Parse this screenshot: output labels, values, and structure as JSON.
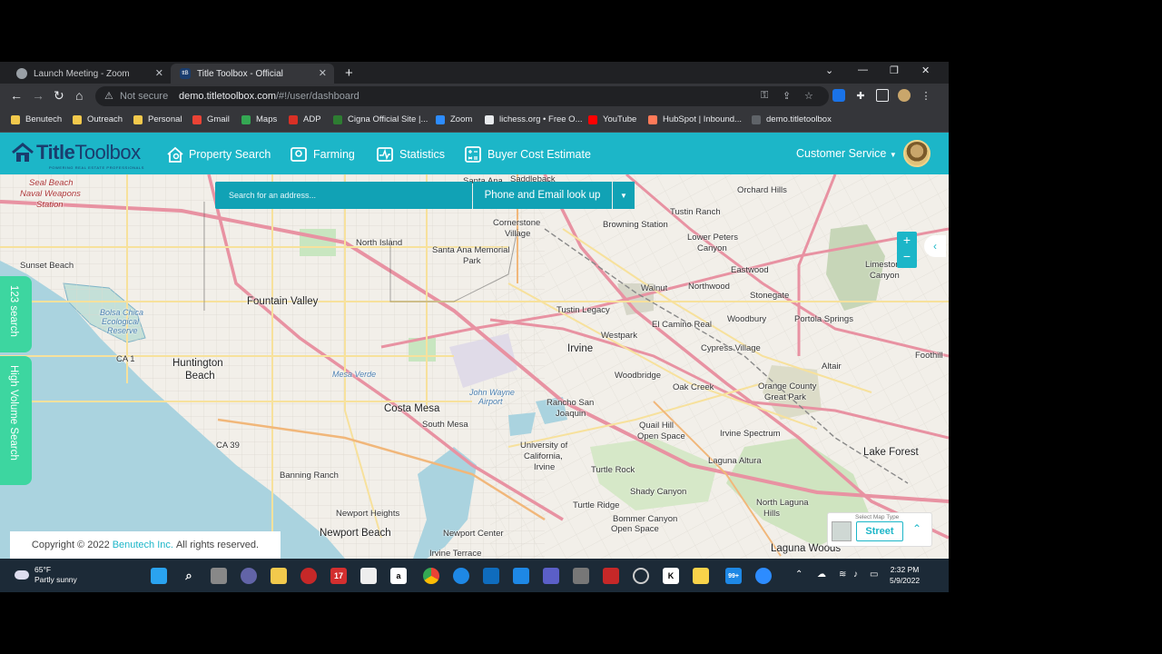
{
  "browser": {
    "tabs": [
      {
        "title": "Launch Meeting - Zoom",
        "active": false
      },
      {
        "title": "Title Toolbox - Official",
        "active": true
      }
    ],
    "security_label": "Not secure",
    "url_host": "demo.titletoolbox.com",
    "url_path": "/#!/user/dashboard",
    "bookmarks": [
      "Benutech",
      "Outreach",
      "Personal",
      "Gmail",
      "Maps",
      "ADP",
      "Cigna Official Site |...",
      "Zoom",
      "lichess.org • Free O...",
      "YouTube",
      "HubSpot | Inbound...",
      "demo.titletoolbox"
    ],
    "bookmark_colors": [
      "#f2c94c",
      "#f2c94c",
      "#f2c94c",
      "#ea4335",
      "#34a853",
      "#d93025",
      "#2e7d32",
      "#2d8cff",
      "#e8eaed",
      "#ff0000",
      "#ff7a59",
      "#5f6368"
    ]
  },
  "app": {
    "logo_bold": "Title",
    "logo_light": "Toolbox",
    "logo_tagline": "POWERING REAL ESTATE PROFESSIONALS",
    "nav": [
      "Property Search",
      "Farming",
      "Statistics",
      "Buyer Cost Estimate"
    ],
    "customer_service": "Customer Service",
    "accent_color": "#1cb6c8",
    "side_tab_color": "#3dd6a0"
  },
  "search": {
    "placeholder": "Search for an address...",
    "phone_button": "Phone and Email look up"
  },
  "side_tabs": [
    "123 search",
    "High Volume Search"
  ],
  "zoom": {
    "plus": "+",
    "minus": "−"
  },
  "map_type": {
    "label": "Select Map Type",
    "current": "Street"
  },
  "footer": {
    "prefix": "Copyright © 2022",
    "company": "Benutech Inc.",
    "suffix": "All rights reserved."
  },
  "map_labels": [
    {
      "text": "Seal Beach",
      "cls": "red"
    },
    {
      "text": "Naval Weapons",
      "cls": "red"
    },
    {
      "text": "Station",
      "cls": "red"
    },
    {
      "text": "Sunset Beach",
      "cls": ""
    },
    {
      "text": "Fountain Valley",
      "cls": "big"
    },
    {
      "text": "Huntington",
      "cls": "big"
    },
    {
      "text": "Beach",
      "cls": "big"
    },
    {
      "text": "Bolsa Chica",
      "cls": "water"
    },
    {
      "text": "Ecological",
      "cls": "water"
    },
    {
      "text": "Reserve",
      "cls": "water"
    },
    {
      "text": "North Island",
      "cls": ""
    },
    {
      "text": "Santa Ana Memorial",
      "cls": ""
    },
    {
      "text": "Park",
      "cls": ""
    },
    {
      "text": "Cornerstone",
      "cls": ""
    },
    {
      "text": "Village",
      "cls": ""
    },
    {
      "text": "Santa Ana",
      "cls": ""
    },
    {
      "text": "Saddleback",
      "cls": ""
    },
    {
      "text": "Browning Station",
      "cls": ""
    },
    {
      "text": "Tustin Ranch",
      "cls": ""
    },
    {
      "text": "Orchard Hills",
      "cls": ""
    },
    {
      "text": "Lower Peters",
      "cls": ""
    },
    {
      "text": "Canyon",
      "cls": ""
    },
    {
      "text": "Eastwood",
      "cls": ""
    },
    {
      "text": "Limestone",
      "cls": ""
    },
    {
      "text": "Canyon",
      "cls": ""
    },
    {
      "text": "Walnut",
      "cls": ""
    },
    {
      "text": "Northwood",
      "cls": ""
    },
    {
      "text": "Stonegate",
      "cls": ""
    },
    {
      "text": "Tustin Legacy",
      "cls": ""
    },
    {
      "text": "El Camino Real",
      "cls": ""
    },
    {
      "text": "Woodbury",
      "cls": ""
    },
    {
      "text": "Portola Springs",
      "cls": ""
    },
    {
      "text": "Irvine",
      "cls": "big"
    },
    {
      "text": "Westpark",
      "cls": ""
    },
    {
      "text": "Cypress Village",
      "cls": ""
    },
    {
      "text": "Foothill",
      "cls": ""
    },
    {
      "text": "Woodbridge",
      "cls": ""
    },
    {
      "text": "Oak Creek",
      "cls": ""
    },
    {
      "text": "Orange County",
      "cls": ""
    },
    {
      "text": "Great Park",
      "cls": ""
    },
    {
      "text": "Altair",
      "cls": ""
    },
    {
      "text": "Mesa Verde",
      "cls": "water"
    },
    {
      "text": "John Wayne",
      "cls": "water"
    },
    {
      "text": "Airport",
      "cls": "water"
    },
    {
      "text": "Costa Mesa",
      "cls": "big"
    },
    {
      "text": "South Mesa",
      "cls": ""
    },
    {
      "text": "Rancho San",
      "cls": ""
    },
    {
      "text": "Joaquin",
      "cls": ""
    },
    {
      "text": "Quail Hill",
      "cls": ""
    },
    {
      "text": "Open Space",
      "cls": ""
    },
    {
      "text": "Irvine Spectrum",
      "cls": ""
    },
    {
      "text": "Lake Forest",
      "cls": "big"
    },
    {
      "text": "University of",
      "cls": ""
    },
    {
      "text": "California,",
      "cls": ""
    },
    {
      "text": "Irvine",
      "cls": ""
    },
    {
      "text": "Turtle Rock",
      "cls": ""
    },
    {
      "text": "Laguna Altura",
      "cls": ""
    },
    {
      "text": "Banning Ranch",
      "cls": ""
    },
    {
      "text": "Shady Canyon",
      "cls": ""
    },
    {
      "text": "Turtle Ridge",
      "cls": ""
    },
    {
      "text": "Newport Heights",
      "cls": ""
    },
    {
      "text": "Bommer Canyon",
      "cls": ""
    },
    {
      "text": "Open Space",
      "cls": ""
    },
    {
      "text": "North Laguna",
      "cls": ""
    },
    {
      "text": "Hills",
      "cls": ""
    },
    {
      "text": "Newport Beach",
      "cls": "big"
    },
    {
      "text": "Newport Center",
      "cls": ""
    },
    {
      "text": "Irvine Terrace",
      "cls": ""
    },
    {
      "text": "Laguna Woods",
      "cls": "big"
    },
    {
      "text": "CA 1",
      "cls": ""
    },
    {
      "text": "CA 39",
      "cls": ""
    }
  ],
  "taskbar": {
    "temp": "65°F",
    "weather": "Partly sunny",
    "time": "2:32 PM",
    "date": "5/9/2022",
    "badge_17": "17",
    "badge_mail": "99+"
  }
}
